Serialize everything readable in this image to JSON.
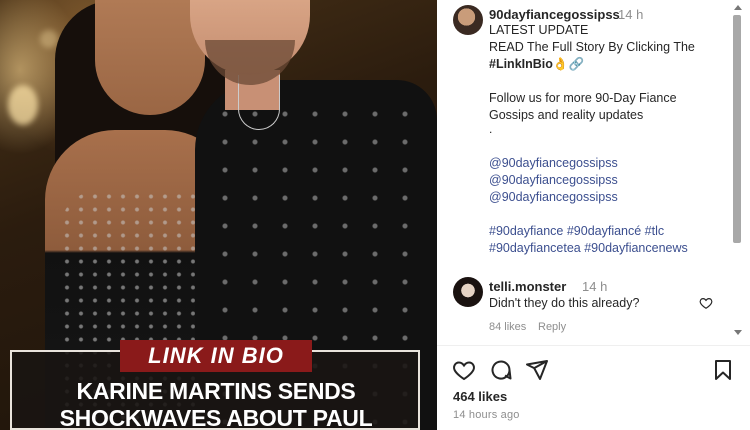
{
  "image": {
    "link_banner": "LINK IN BIO",
    "headline_line1": "KARINE MARTINS SENDS",
    "headline_line2": "SHOCKWAVES ABOUT PAUL"
  },
  "post": {
    "username": "90dayfiancegossipss",
    "time": "14 h",
    "caption": {
      "line1": "LATEST UPDATE",
      "line2": "READ The Full Story By Clicking The",
      "hashtag_link": "#LinkInBio",
      "emoji": "👌🔗",
      "line4": "Follow us for more 90-Day Fiance",
      "line5": "Gossips and reality updates",
      "dot": ".",
      "mentions": [
        "@90dayfiancegossipss",
        "@90dayfiancegossipss",
        "@90dayfiancegossipss"
      ],
      "tags_line1": "#90dayfiance #90dayfiancé #tlc",
      "tags_line2": "#90dayfiancetea #90dayfiancenews"
    }
  },
  "comment": {
    "username": "telli.monster",
    "time": "14 h",
    "text": "Didn't they do this already?",
    "likes": "84 likes",
    "reply": "Reply",
    "icon": "heart-icon"
  },
  "footer": {
    "likes_count": "464 likes",
    "age": "14 hours ago",
    "icons": [
      "heart-icon",
      "comment-icon",
      "share-icon",
      "bookmark-icon"
    ]
  },
  "colors": {
    "banner_red": "#8a1a1a",
    "link_blue": "#3c4f8f",
    "muted": "#8e8e8e"
  }
}
